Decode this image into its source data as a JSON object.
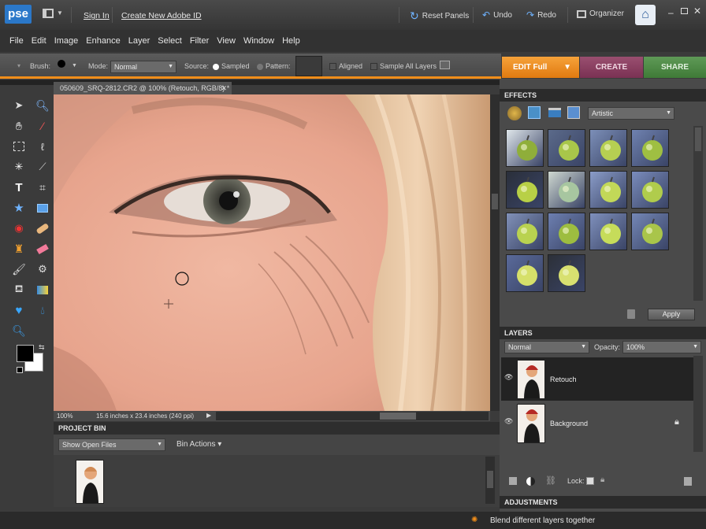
{
  "app": {
    "logo": "pse",
    "sign_in": "Sign In",
    "create_id": "Create New Adobe ID"
  },
  "titlebar": {
    "reset_panels": "Reset Panels",
    "undo": "Undo",
    "redo": "Redo",
    "organizer": "Organizer"
  },
  "menu": [
    "File",
    "Edit",
    "Image",
    "Enhance",
    "Layer",
    "Select",
    "Filter",
    "View",
    "Window",
    "Help"
  ],
  "options": {
    "brush_label": "Brush:",
    "mode_label": "Mode:",
    "mode_value": "Normal",
    "source_label": "Source:",
    "sampled": "Sampled",
    "pattern": "Pattern:",
    "aligned": "Aligned",
    "sample_all": "Sample All Layers"
  },
  "mode_tabs": {
    "edit": "EDIT Full",
    "create": "CREATE",
    "share": "SHARE"
  },
  "document": {
    "tab_title": "050609_SRQ-2812.CR2 @ 100% (Retouch, RGB/8) *",
    "zoom": "100%",
    "doc_info": "15.6 inches x 23.4 inches (240 ppi)"
  },
  "effects": {
    "title": "EFFECTS",
    "category": "Artistic",
    "apply": "Apply",
    "thumb_count": 14
  },
  "layers": {
    "title": "LAYERS",
    "blend_mode": "Normal",
    "opacity_label": "Opacity:",
    "opacity_value": "100%",
    "lock_label": "Lock:",
    "items": [
      {
        "name": "Retouch",
        "selected": true
      },
      {
        "name": "Background",
        "selected": false
      }
    ]
  },
  "project_bin": {
    "title": "PROJECT BIN",
    "show": "Show Open Files",
    "actions": "Bin Actions"
  },
  "adjustments": {
    "title": "ADJUSTMENTS"
  },
  "hint": "Blend different layers together",
  "colors": {
    "accent_orange": "#f08d1a",
    "create": "#8a3d60",
    "share": "#4c8a44",
    "logo_blue": "#2b78c9"
  }
}
